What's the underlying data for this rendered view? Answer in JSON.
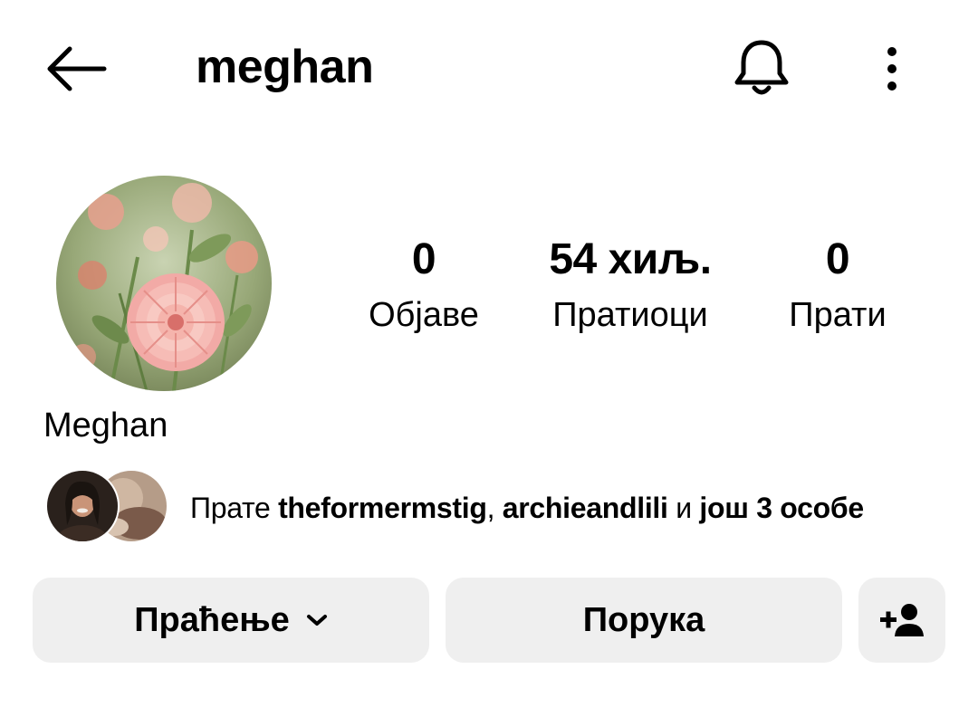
{
  "header": {
    "username": "meghan",
    "back_icon": "arrow-left-icon",
    "notifications_icon": "bell-icon",
    "more_icon": "more-vertical-icon"
  },
  "profile": {
    "display_name": "Meghan",
    "avatar": "flower-photo"
  },
  "stats": {
    "posts": {
      "value": "0",
      "label": "Објаве"
    },
    "followers": {
      "value": "54 хиљ.",
      "label": "Пратиоци"
    },
    "following": {
      "value": "0",
      "label": "Прати"
    }
  },
  "followed_by": {
    "prefix": "Прате ",
    "user1": "theformermstig",
    "separator": ", ",
    "user2": "archieandlili",
    "middle": " и ",
    "rest": "још 3 особе"
  },
  "actions": {
    "following_label": "Праћење",
    "message_label": "Порука",
    "add_person_icon": "person-add-icon"
  },
  "colors": {
    "button_bg": "#efefef",
    "text": "#000000",
    "background": "#ffffff"
  }
}
